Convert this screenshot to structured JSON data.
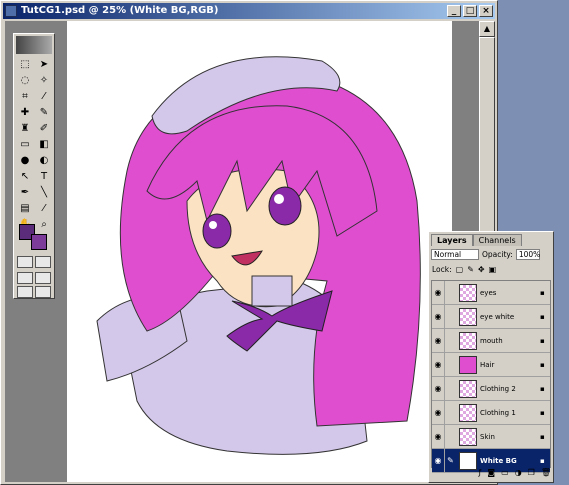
{
  "window": {
    "title": "TutCG1.psd @ 25% (White BG,RGB)"
  },
  "titlebar_buttons": [
    "_",
    "□",
    "×"
  ],
  "toolbox": {
    "icons": [
      "marquee-icon",
      "lasso-icon",
      "crop-icon",
      "brush-icon",
      "stamp-icon",
      "eraser-icon",
      "gradient-icon",
      "burn-icon",
      "path-select-icon",
      "type-icon",
      "pen-icon",
      "shape-icon",
      "notes-icon",
      "eyedropper-icon",
      "hand-icon",
      "zoom-icon"
    ]
  },
  "colors": {
    "foreground": "#5a2c7a",
    "background": "#7c3a99",
    "accent_blue": "#0a246a",
    "hair": "#e04ed0",
    "clothing": "#d4c8ea",
    "bow": "#8a2aa8",
    "skin": "#fbe2c2"
  },
  "layers_panel": {
    "tabs": [
      "Layers",
      "Channels"
    ],
    "blend_mode": "Normal",
    "opacity_label": "Opacity:",
    "opacity_value": "100%",
    "lock_label": "Lock:",
    "layers": [
      {
        "name": "eyes"
      },
      {
        "name": "eye white"
      },
      {
        "name": "mouth"
      },
      {
        "name": "Hair"
      },
      {
        "name": "Clothing 2"
      },
      {
        "name": "Clothing 1"
      },
      {
        "name": "Skin"
      },
      {
        "name": "White BG"
      }
    ]
  }
}
